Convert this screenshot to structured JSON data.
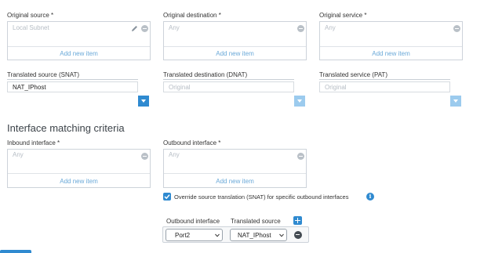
{
  "original_source": {
    "label": "Original source *",
    "value": "Local Subnet",
    "add": "Add new item"
  },
  "original_destination": {
    "label": "Original destination *",
    "value": "Any",
    "add": "Add new item"
  },
  "original_service": {
    "label": "Original service *",
    "value": "Any",
    "add": "Add new item"
  },
  "translated_source": {
    "label": "Translated source (SNAT)",
    "value": "NAT_IPhost"
  },
  "translated_destination": {
    "label": "Translated destination (DNAT)",
    "value": "Original"
  },
  "translated_service": {
    "label": "Translated service (PAT)",
    "value": "Original"
  },
  "section_title": "Interface matching criteria",
  "inbound": {
    "label": "Inbound interface *",
    "value": "Any",
    "add": "Add new item"
  },
  "outbound": {
    "label": "Outbound interface *",
    "value": "Any",
    "add": "Add new item"
  },
  "override": {
    "label": "Override source translation (SNAT) for specific outbound interfaces",
    "checked": true
  },
  "mapping": {
    "col_outbound": "Outbound interface",
    "col_translated": "Translated source",
    "row": {
      "outbound": "Port2",
      "translated": "NAT_IPhost"
    }
  },
  "colors": {
    "accent": "#2f8ad0",
    "light_accent": "#9ccbee"
  },
  "icons": [
    "edit-icon",
    "minus-icon",
    "chevron-down-icon",
    "info-icon",
    "plus-icon",
    "check-icon"
  ]
}
